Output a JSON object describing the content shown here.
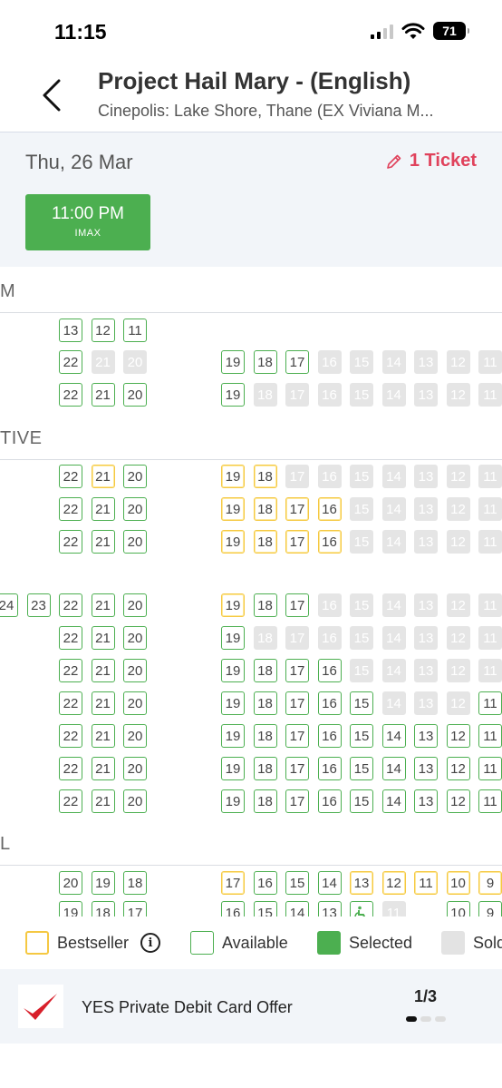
{
  "status_bar": {
    "time": "11:15",
    "battery": "71",
    "icons": [
      "signal-icon",
      "wifi-icon",
      "battery-icon"
    ]
  },
  "header": {
    "title": "Project Hail Mary - (English)",
    "venue": "Cinepolis: Lake Shore, Thane (EX Viviana M...",
    "back_icon": "chevron-left-icon"
  },
  "date_panel": {
    "date": "Thu, 26 Mar",
    "ticket_count": "1 Ticket",
    "showtime": {
      "time": "11:00 PM",
      "format": "IMAX"
    }
  },
  "colors": {
    "accent": "#4caf50",
    "ticket": "#e0425c",
    "bestseller": "#f5c842",
    "sold": "#e5e5e5"
  },
  "seat_map": {
    "sections": [
      {
        "label": "M"
      },
      {
        "label": "TIVE"
      },
      {
        "label": "L"
      }
    ],
    "rows": [
      {
        "left": [
          [
            "13",
            "a"
          ],
          [
            "12",
            "a"
          ],
          [
            "11",
            "a"
          ]
        ],
        "right": []
      },
      {
        "left": [
          [
            "22",
            "a"
          ],
          [
            "21",
            "s"
          ],
          [
            "20",
            "s"
          ]
        ],
        "right": [
          [
            "19",
            "a"
          ],
          [
            "18",
            "a"
          ],
          [
            "17",
            "a"
          ],
          [
            "16",
            "s"
          ],
          [
            "15",
            "s"
          ],
          [
            "14",
            "s"
          ],
          [
            "13",
            "s"
          ],
          [
            "12",
            "s"
          ],
          [
            "11",
            "s"
          ]
        ]
      },
      {
        "left": [
          [
            "22",
            "a"
          ],
          [
            "21",
            "a"
          ],
          [
            "20",
            "a"
          ]
        ],
        "right": [
          [
            "19",
            "a"
          ],
          [
            "18",
            "s"
          ],
          [
            "17",
            "s"
          ],
          [
            "16",
            "s"
          ],
          [
            "15",
            "s"
          ],
          [
            "14",
            "s"
          ],
          [
            "13",
            "s"
          ],
          [
            "12",
            "s"
          ],
          [
            "11",
            "s"
          ]
        ]
      },
      {
        "left": [
          [
            "22",
            "a"
          ],
          [
            "21",
            "b"
          ],
          [
            "20",
            "a"
          ]
        ],
        "right": [
          [
            "19",
            "b"
          ],
          [
            "18",
            "b"
          ],
          [
            "17",
            "s"
          ],
          [
            "16",
            "s"
          ],
          [
            "15",
            "s"
          ],
          [
            "14",
            "s"
          ],
          [
            "13",
            "s"
          ],
          [
            "12",
            "s"
          ],
          [
            "11",
            "s"
          ]
        ]
      },
      {
        "left": [
          [
            "22",
            "a"
          ],
          [
            "21",
            "a"
          ],
          [
            "20",
            "a"
          ]
        ],
        "right": [
          [
            "19",
            "b"
          ],
          [
            "18",
            "b"
          ],
          [
            "17",
            "b"
          ],
          [
            "16",
            "b"
          ],
          [
            "15",
            "s"
          ],
          [
            "14",
            "s"
          ],
          [
            "13",
            "s"
          ],
          [
            "12",
            "s"
          ],
          [
            "11",
            "s"
          ]
        ]
      },
      {
        "left": [
          [
            "22",
            "a"
          ],
          [
            "21",
            "a"
          ],
          [
            "20",
            "a"
          ]
        ],
        "right": [
          [
            "19",
            "b"
          ],
          [
            "18",
            "b"
          ],
          [
            "17",
            "b"
          ],
          [
            "16",
            "b"
          ],
          [
            "15",
            "s"
          ],
          [
            "14",
            "s"
          ],
          [
            "13",
            "s"
          ],
          [
            "12",
            "s"
          ],
          [
            "11",
            "s"
          ]
        ]
      },
      {
        "left": [
          [
            "24",
            "a"
          ],
          [
            "23",
            "a"
          ],
          [
            "22",
            "a"
          ],
          [
            "21",
            "a"
          ],
          [
            "20",
            "a"
          ]
        ],
        "right": [
          [
            "19",
            "b"
          ],
          [
            "18",
            "a"
          ],
          [
            "17",
            "a"
          ],
          [
            "16",
            "s"
          ],
          [
            "15",
            "s"
          ],
          [
            "14",
            "s"
          ],
          [
            "13",
            "s"
          ],
          [
            "12",
            "s"
          ],
          [
            "11",
            "s"
          ]
        ]
      },
      {
        "left": [
          [
            "22",
            "a"
          ],
          [
            "21",
            "a"
          ],
          [
            "20",
            "a"
          ]
        ],
        "right": [
          [
            "19",
            "a"
          ],
          [
            "18",
            "s"
          ],
          [
            "17",
            "s"
          ],
          [
            "16",
            "s"
          ],
          [
            "15",
            "s"
          ],
          [
            "14",
            "s"
          ],
          [
            "13",
            "s"
          ],
          [
            "12",
            "s"
          ],
          [
            "11",
            "s"
          ]
        ]
      },
      {
        "left": [
          [
            "22",
            "a"
          ],
          [
            "21",
            "a"
          ],
          [
            "20",
            "a"
          ]
        ],
        "right": [
          [
            "19",
            "a"
          ],
          [
            "18",
            "a"
          ],
          [
            "17",
            "a"
          ],
          [
            "16",
            "a"
          ],
          [
            "15",
            "s"
          ],
          [
            "14",
            "s"
          ],
          [
            "13",
            "s"
          ],
          [
            "12",
            "s"
          ],
          [
            "11",
            "s"
          ]
        ]
      },
      {
        "left": [
          [
            "22",
            "a"
          ],
          [
            "21",
            "a"
          ],
          [
            "20",
            "a"
          ]
        ],
        "right": [
          [
            "19",
            "a"
          ],
          [
            "18",
            "a"
          ],
          [
            "17",
            "a"
          ],
          [
            "16",
            "a"
          ],
          [
            "15",
            "a"
          ],
          [
            "14",
            "s"
          ],
          [
            "13",
            "s"
          ],
          [
            "12",
            "s"
          ],
          [
            "11",
            "a"
          ]
        ]
      },
      {
        "left": [
          [
            "22",
            "a"
          ],
          [
            "21",
            "a"
          ],
          [
            "20",
            "a"
          ]
        ],
        "right": [
          [
            "19",
            "a"
          ],
          [
            "18",
            "a"
          ],
          [
            "17",
            "a"
          ],
          [
            "16",
            "a"
          ],
          [
            "15",
            "a"
          ],
          [
            "14",
            "a"
          ],
          [
            "13",
            "a"
          ],
          [
            "12",
            "a"
          ],
          [
            "11",
            "a"
          ]
        ]
      },
      {
        "left": [
          [
            "22",
            "a"
          ],
          [
            "21",
            "a"
          ],
          [
            "20",
            "a"
          ]
        ],
        "right": [
          [
            "19",
            "a"
          ],
          [
            "18",
            "a"
          ],
          [
            "17",
            "a"
          ],
          [
            "16",
            "a"
          ],
          [
            "15",
            "a"
          ],
          [
            "14",
            "a"
          ],
          [
            "13",
            "a"
          ],
          [
            "12",
            "a"
          ],
          [
            "11",
            "a"
          ]
        ]
      },
      {
        "left": [
          [
            "22",
            "a"
          ],
          [
            "21",
            "a"
          ],
          [
            "20",
            "a"
          ]
        ],
        "right": [
          [
            "19",
            "a"
          ],
          [
            "18",
            "a"
          ],
          [
            "17",
            "a"
          ],
          [
            "16",
            "a"
          ],
          [
            "15",
            "a"
          ],
          [
            "14",
            "a"
          ],
          [
            "13",
            "a"
          ],
          [
            "12",
            "a"
          ],
          [
            "11",
            "a"
          ]
        ]
      },
      {
        "left": [
          [
            "20",
            "a"
          ],
          [
            "19",
            "a"
          ],
          [
            "18",
            "a"
          ]
        ],
        "right": [
          [
            "17",
            "b"
          ],
          [
            "16",
            "a"
          ],
          [
            "15",
            "a"
          ],
          [
            "14",
            "a"
          ],
          [
            "13",
            "b"
          ],
          [
            "12",
            "b"
          ],
          [
            "11",
            "b"
          ],
          [
            "10",
            "b"
          ],
          [
            "9",
            "b"
          ]
        ]
      },
      {
        "left": [
          [
            "19",
            "a"
          ],
          [
            "18",
            "a"
          ],
          [
            "17",
            "a"
          ]
        ],
        "right": [
          [
            "16",
            "a"
          ],
          [
            "15",
            "a"
          ],
          [
            "14",
            "a"
          ],
          [
            "13",
            "a"
          ],
          [
            "wheelchair-icon",
            "a"
          ],
          [
            "11",
            "s"
          ],
          [
            "",
            ""
          ],
          [
            "10",
            "a"
          ],
          [
            "9",
            "a"
          ]
        ]
      }
    ]
  },
  "legend": {
    "bestseller": "Bestseller",
    "available": "Available",
    "selected": "Selected",
    "sold": "Sold"
  },
  "offer": {
    "text": "YES Private Debit Card Offer",
    "pager": "1/3"
  }
}
